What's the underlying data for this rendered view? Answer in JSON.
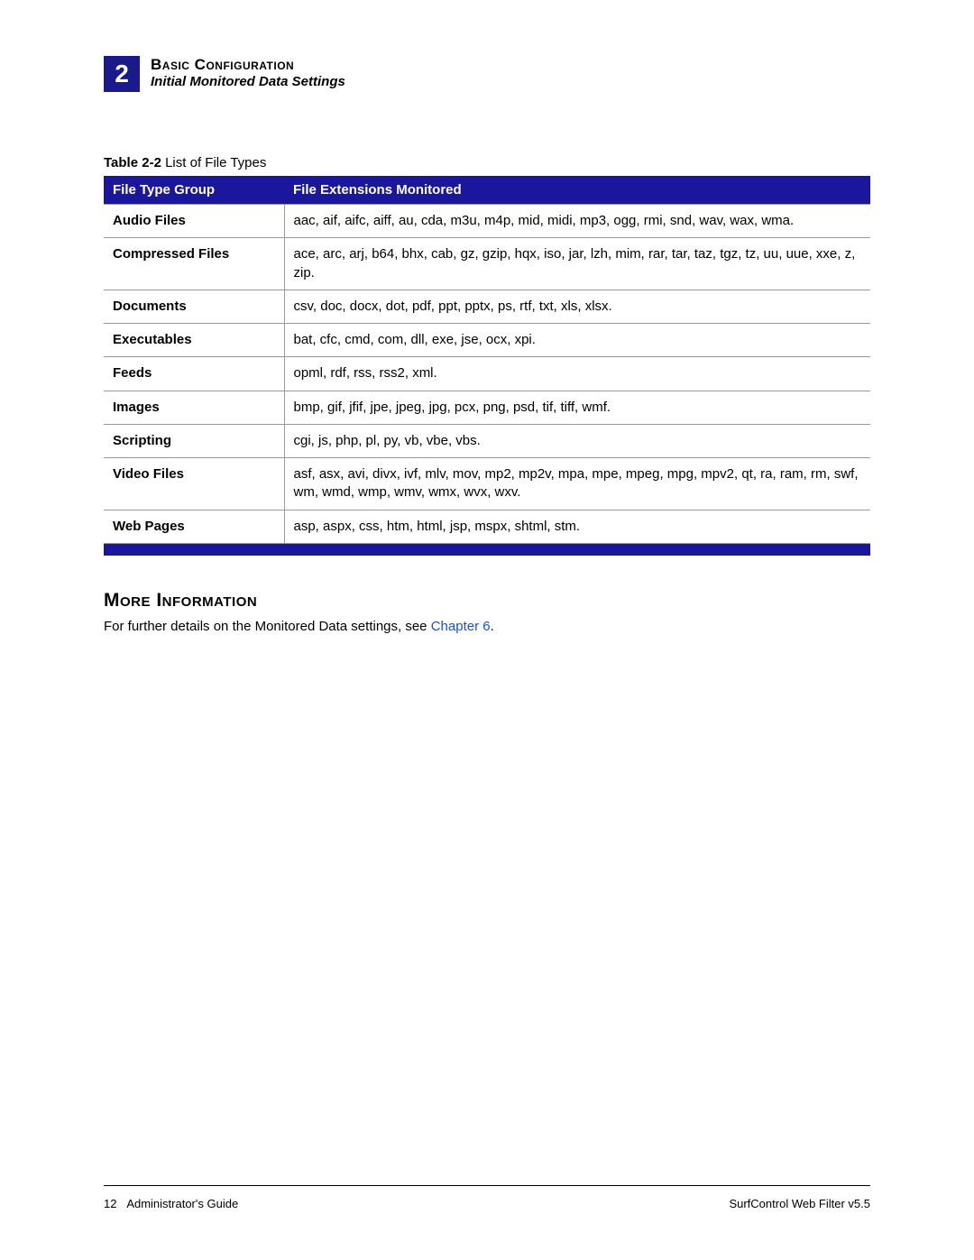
{
  "header": {
    "chapter_number": "2",
    "chapter_title": "Basic Configuration",
    "section_subtitle": "Initial Monitored Data Settings"
  },
  "table_caption_label": "Table 2-2",
  "table_caption_text": "  List of File Types",
  "column_headers": {
    "group": "File Type Group",
    "ext": "File Extensions Monitored"
  },
  "rows": [
    {
      "group": "Audio Files",
      "ext": "aac, aif, aifc, aiff, au, cda, m3u, m4p, mid, midi, mp3, ogg, rmi, snd, wav, wax, wma."
    },
    {
      "group": "Compressed Files",
      "ext": "ace, arc, arj, b64, bhx, cab, gz, gzip, hqx, iso, jar, lzh, mim, rar, tar, taz, tgz, tz, uu, uue, xxe, z, zip."
    },
    {
      "group": "Documents",
      "ext": "csv, doc, docx, dot, pdf, ppt, pptx, ps, rtf, txt, xls, xlsx."
    },
    {
      "group": "Executables",
      "ext": "bat, cfc, cmd, com, dll, exe, jse, ocx, xpi."
    },
    {
      "group": "Feeds",
      "ext": "opml, rdf, rss, rss2, xml."
    },
    {
      "group": "Images",
      "ext": "bmp, gif, jfif, jpe, jpeg, jpg, pcx, png, psd, tif, tiff, wmf."
    },
    {
      "group": "Scripting",
      "ext": "cgi, js, php, pl, py, vb, vbe, vbs."
    },
    {
      "group": "Video Files",
      "ext": "asf, asx, avi, divx, ivf, mlv, mov, mp2, mp2v, mpa, mpe, mpeg, mpg, mpv2, qt, ra, ram, rm, swf, wm, wmd, wmp, wmv, wmx, wvx, wxv."
    },
    {
      "group": "Web Pages",
      "ext": "asp, aspx, css, htm, html, jsp, mspx, shtml, stm."
    }
  ],
  "more_info": {
    "heading": "More Information",
    "text_prefix": "For further details on the Monitored Data settings, see ",
    "link_text": "Chapter 6",
    "suffix": "."
  },
  "footer": {
    "page_number": "12",
    "guide_label": "Administrator's Guide",
    "product": "SurfControl Web Filter v5.5"
  }
}
